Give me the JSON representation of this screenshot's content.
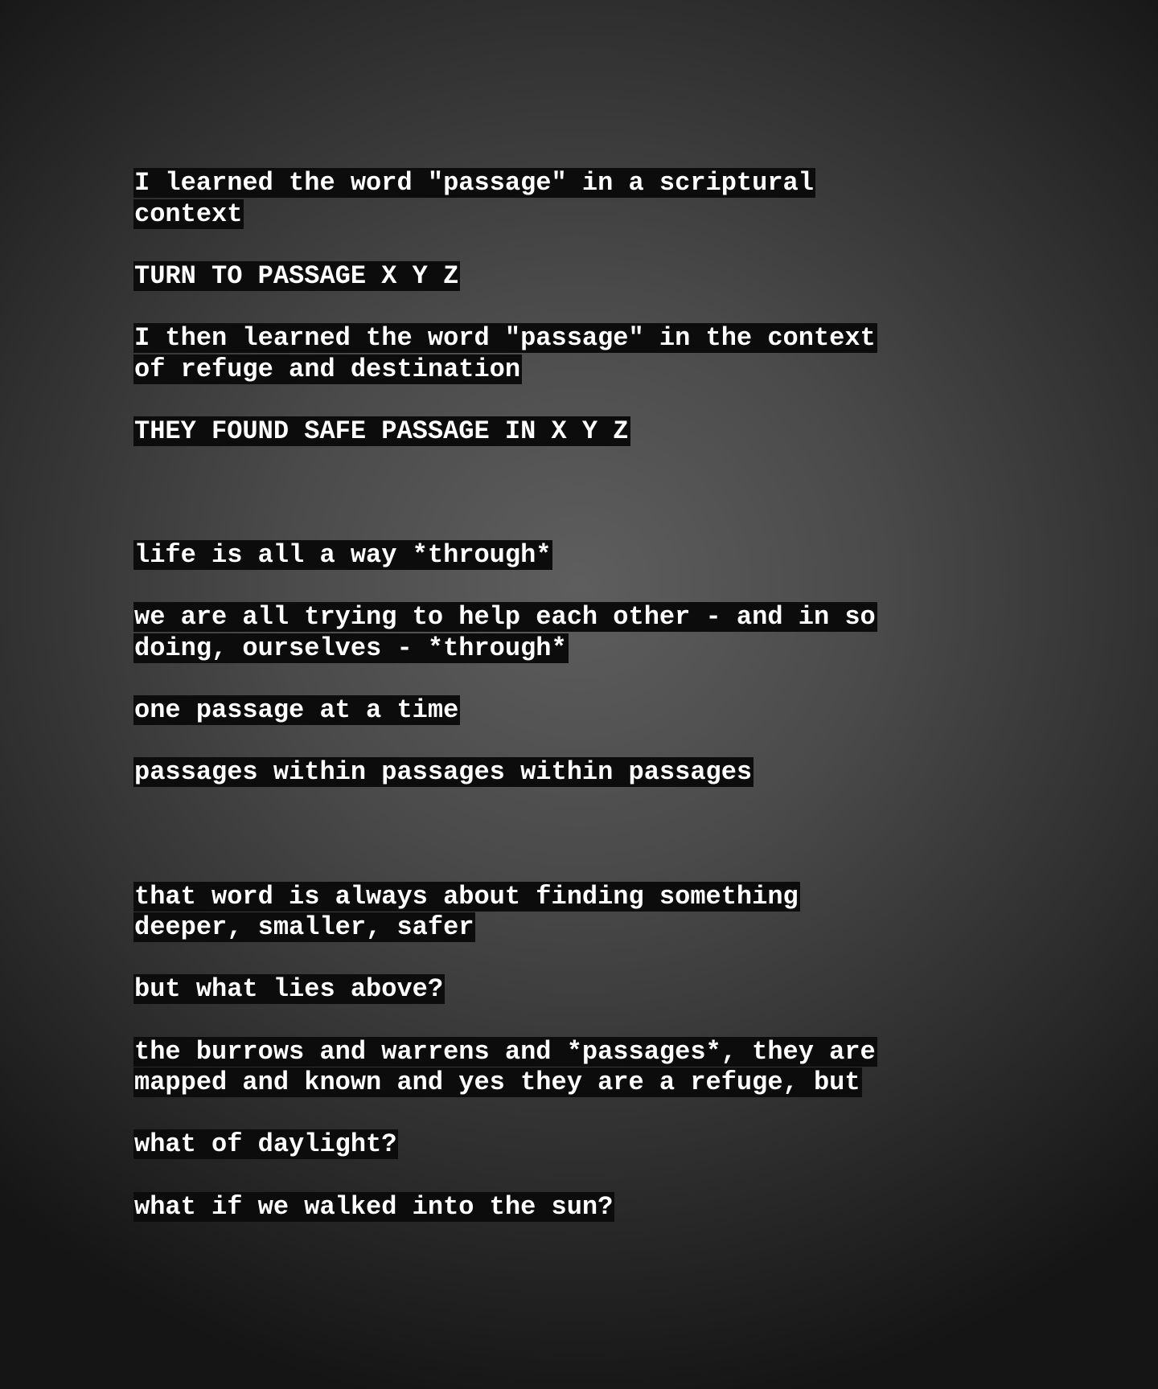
{
  "lines": [
    [
      "I learned the word \"passage\" in a scriptural",
      "context"
    ],
    [
      "TURN TO PASSAGE X Y Z"
    ],
    [
      "I then learned the word \"passage\" in the context",
      "of refuge and destination"
    ],
    [
      "THEY FOUND SAFE PASSAGE IN X Y Z"
    ],
    [
      "life is all a way *through*"
    ],
    [
      "we are all trying to help each other - and in so",
      "doing, ourselves - *through*"
    ],
    [
      "one passage at a time"
    ],
    [
      "passages within passages within passages"
    ],
    [
      "that word is always about finding something",
      "deeper, smaller, safer"
    ],
    [
      "but what lies above?"
    ],
    [
      "the burrows and warrens and *passages*, they are",
      "mapped and known and yes they are a refuge, but"
    ],
    [
      "what of daylight?"
    ],
    [
      "what if we walked into the sun?"
    ]
  ]
}
